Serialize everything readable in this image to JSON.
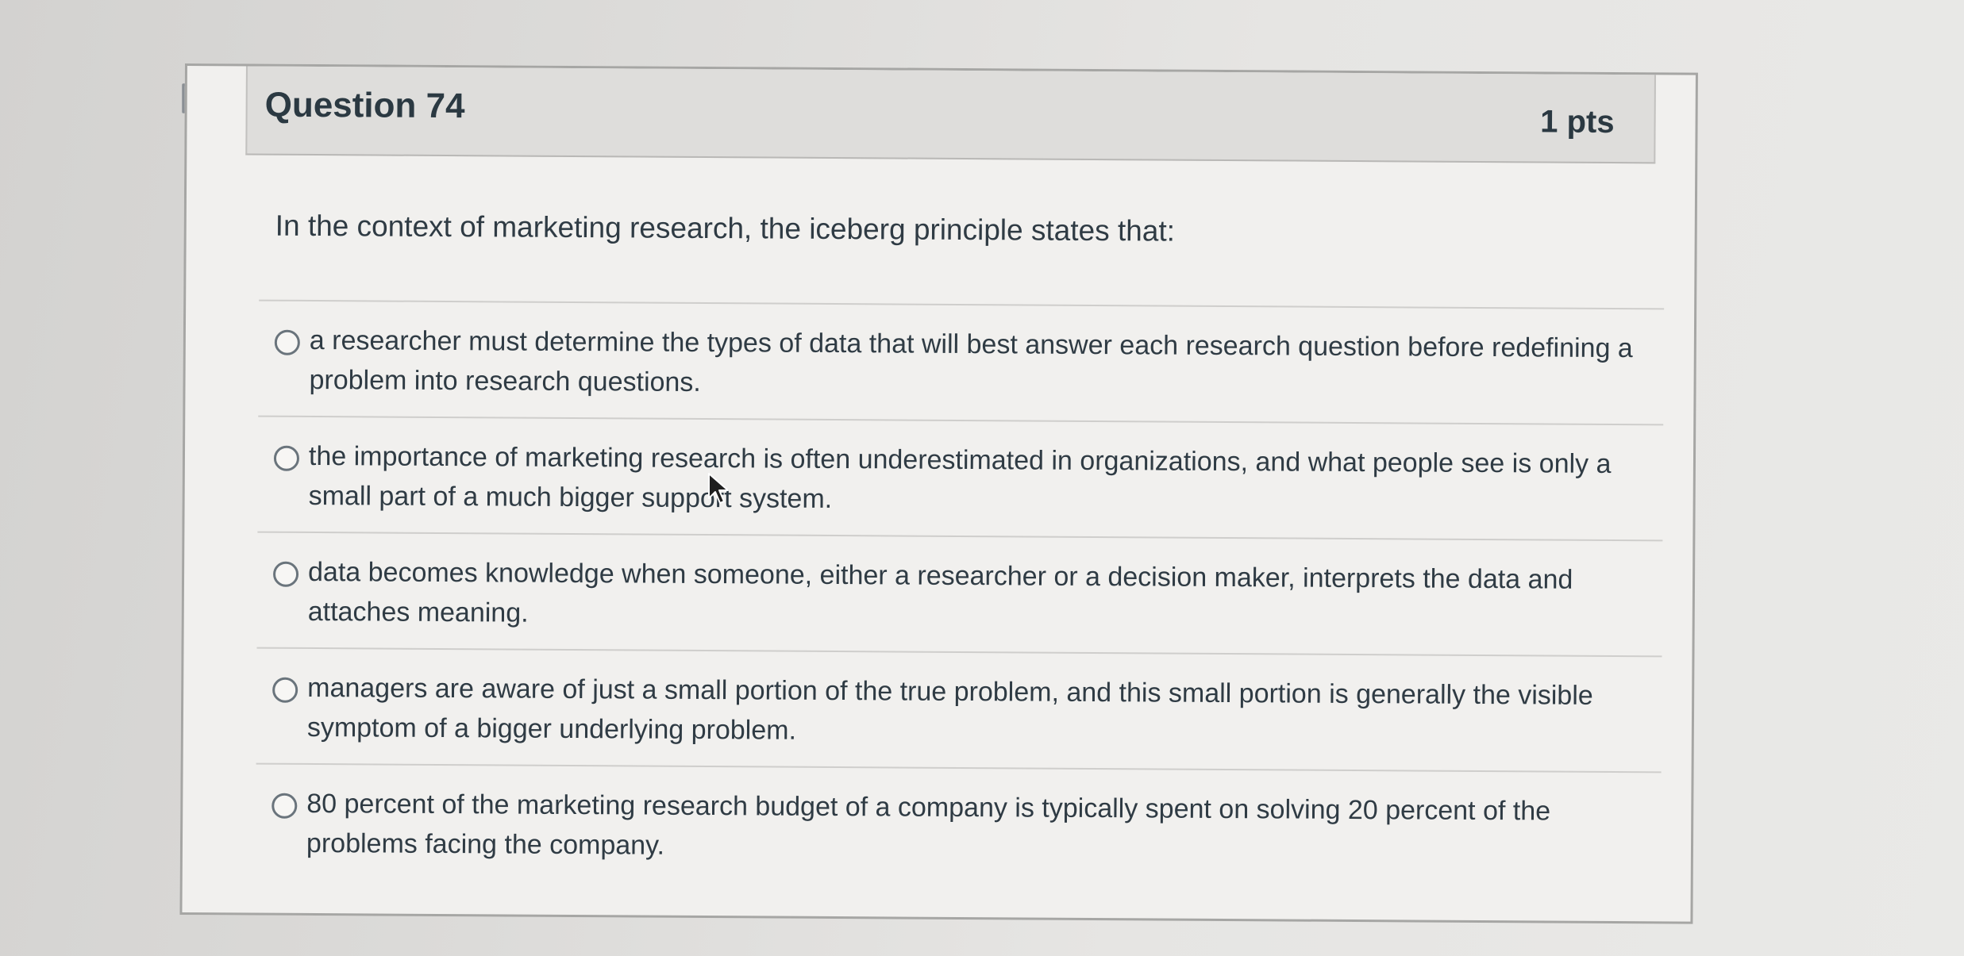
{
  "question": {
    "title": "Question 74",
    "points": "1 pts",
    "text": "In the context of marketing research, the iceberg principle states that:"
  },
  "answers": [
    {
      "label": "a researcher must determine the types of data that will best answer each research question before redefining a problem into research questions."
    },
    {
      "label": "the importance of marketing research is often underestimated in organizations, and what people see is only a small part of a much bigger support system."
    },
    {
      "label": "data becomes knowledge when someone, either a researcher or a decision maker, interprets the data and attaches meaning."
    },
    {
      "label": "managers are aware of just a small portion of the true problem, and this small portion is generally the visible symptom of a bigger underlying problem."
    },
    {
      "label": "80 percent of the marketing research budget of a company is typically spent on solving 20 percent of the problems facing the company."
    }
  ],
  "icons": {
    "flag": "flag-question-icon",
    "cursor": "mouse-cursor-icon"
  }
}
